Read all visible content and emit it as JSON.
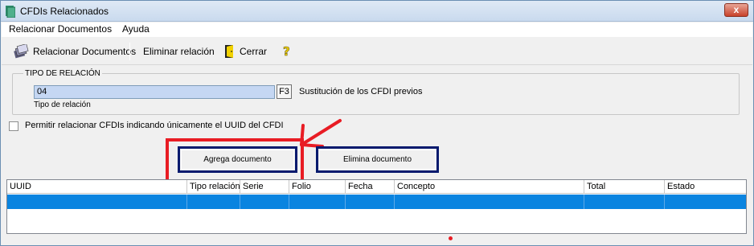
{
  "window": {
    "title": "CFDIs Relacionados",
    "close_glyph": "x"
  },
  "menu": {
    "items": [
      "Relacionar Documentos",
      "Ayuda"
    ]
  },
  "toolbar": {
    "relacionar_label": "Relacionar Documentos",
    "eliminar_label": "Eliminar relación",
    "cerrar_label": "Cerrar",
    "icons": [
      "documents-icon",
      "exit-door-icon",
      "help-question-icon"
    ]
  },
  "tipo_relacion": {
    "group_title": "TIPO DE RELACIÓN",
    "value": "04",
    "caption": "Tipo de relación",
    "f3_label": "F3",
    "description": "Sustitución de los CFDI previos"
  },
  "checkbox": {
    "label": "Permitir relacionar CFDIs indicando únicamente el UUID del CFDI",
    "checked": false
  },
  "buttons": {
    "agrega": "Agrega documento",
    "elimina": "Elimina documento"
  },
  "grid": {
    "columns": [
      "UUID",
      "Tipo relación",
      "Serie",
      "Folio",
      "Fecha",
      "Concepto",
      "Total",
      "Estado"
    ],
    "selected_row_color": "#0a84e0"
  },
  "colors": {
    "annotation_red": "#e81c24",
    "button_border": "#061a6e",
    "input_bg": "#c5d7f3"
  }
}
